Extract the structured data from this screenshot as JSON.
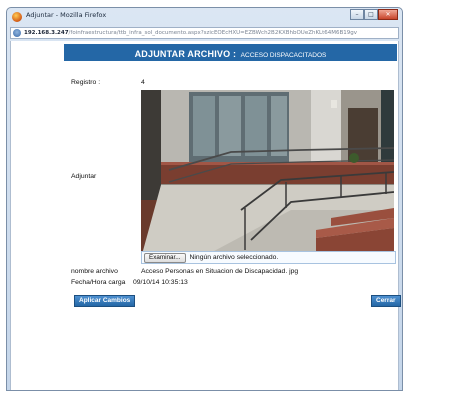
{
  "window": {
    "title": "Adjuntar - Mozilla Firefox",
    "controls": {
      "minimize": "–",
      "maximize": "□",
      "close": "✕"
    }
  },
  "urlbar": {
    "host": "192.168.3.247",
    "path": "/foinfraestructura/ttb_infra_sol_documento.aspx?szicEOEcHXU=EZBWch2B2KXBhbOUeZhKLt64M6B19gv"
  },
  "header": {
    "title": "ADJUNTAR ARCHIVO :",
    "subtitle": "ACCESO DISPACACITADOS"
  },
  "form": {
    "registro_label": "Registro :",
    "registro_value": "4",
    "adjuntar_label": "Adjuntar",
    "browse_button": "Examinar...",
    "no_file_text": "Ningún archivo seleccionado.",
    "nombre_label": "nombre archivo",
    "nombre_value": "Acceso Personas en Situacion de Discapacidad. jpg",
    "fecha_label": "Fecha/Hora carga",
    "fecha_value": "09/10/14  10:35:13"
  },
  "actions": {
    "apply": "Aplicar Cambios",
    "close": "Cerrar"
  }
}
